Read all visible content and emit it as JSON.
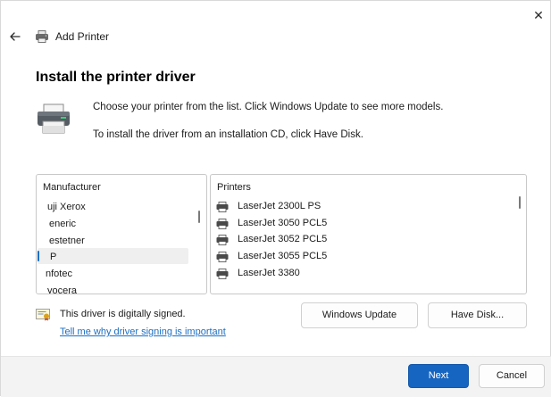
{
  "window": {
    "close_glyph": "✕",
    "nav_title": "Add Printer",
    "icons": {
      "back": "back-arrow-icon",
      "printer": "printer-icon",
      "close": "close-icon"
    }
  },
  "main": {
    "heading": "Install the printer driver",
    "description_line1": "Choose your printer from the list. Click Windows Update to see more models.",
    "description_line2": "To install the driver from an installation CD, click Have Disk."
  },
  "manufacturer_list": {
    "header": "Manufacturer",
    "items": [
      "uji Xerox",
      "eneric",
      "estetner",
      "P",
      "nfotec",
      "yocera"
    ],
    "selected_item": "P"
  },
  "printer_list": {
    "header": "Printers",
    "items": [
      "LaserJet 2300L PS",
      "LaserJet 3050 PCL5",
      "LaserJet 3052 PCL5",
      "LaserJet 3055 PCL5",
      "LaserJet 3380"
    ]
  },
  "signing": {
    "status_text": "This driver is digitally signed.",
    "link_text": "Tell me why driver signing is important"
  },
  "buttons": {
    "windows_update": "Windows Update",
    "have_disk": "Have Disk...",
    "next": "Next",
    "cancel": "Cancel"
  },
  "colors": {
    "accent": "#1665c0",
    "link": "#1b6fc4",
    "footer_bg": "#f3f3f3"
  }
}
